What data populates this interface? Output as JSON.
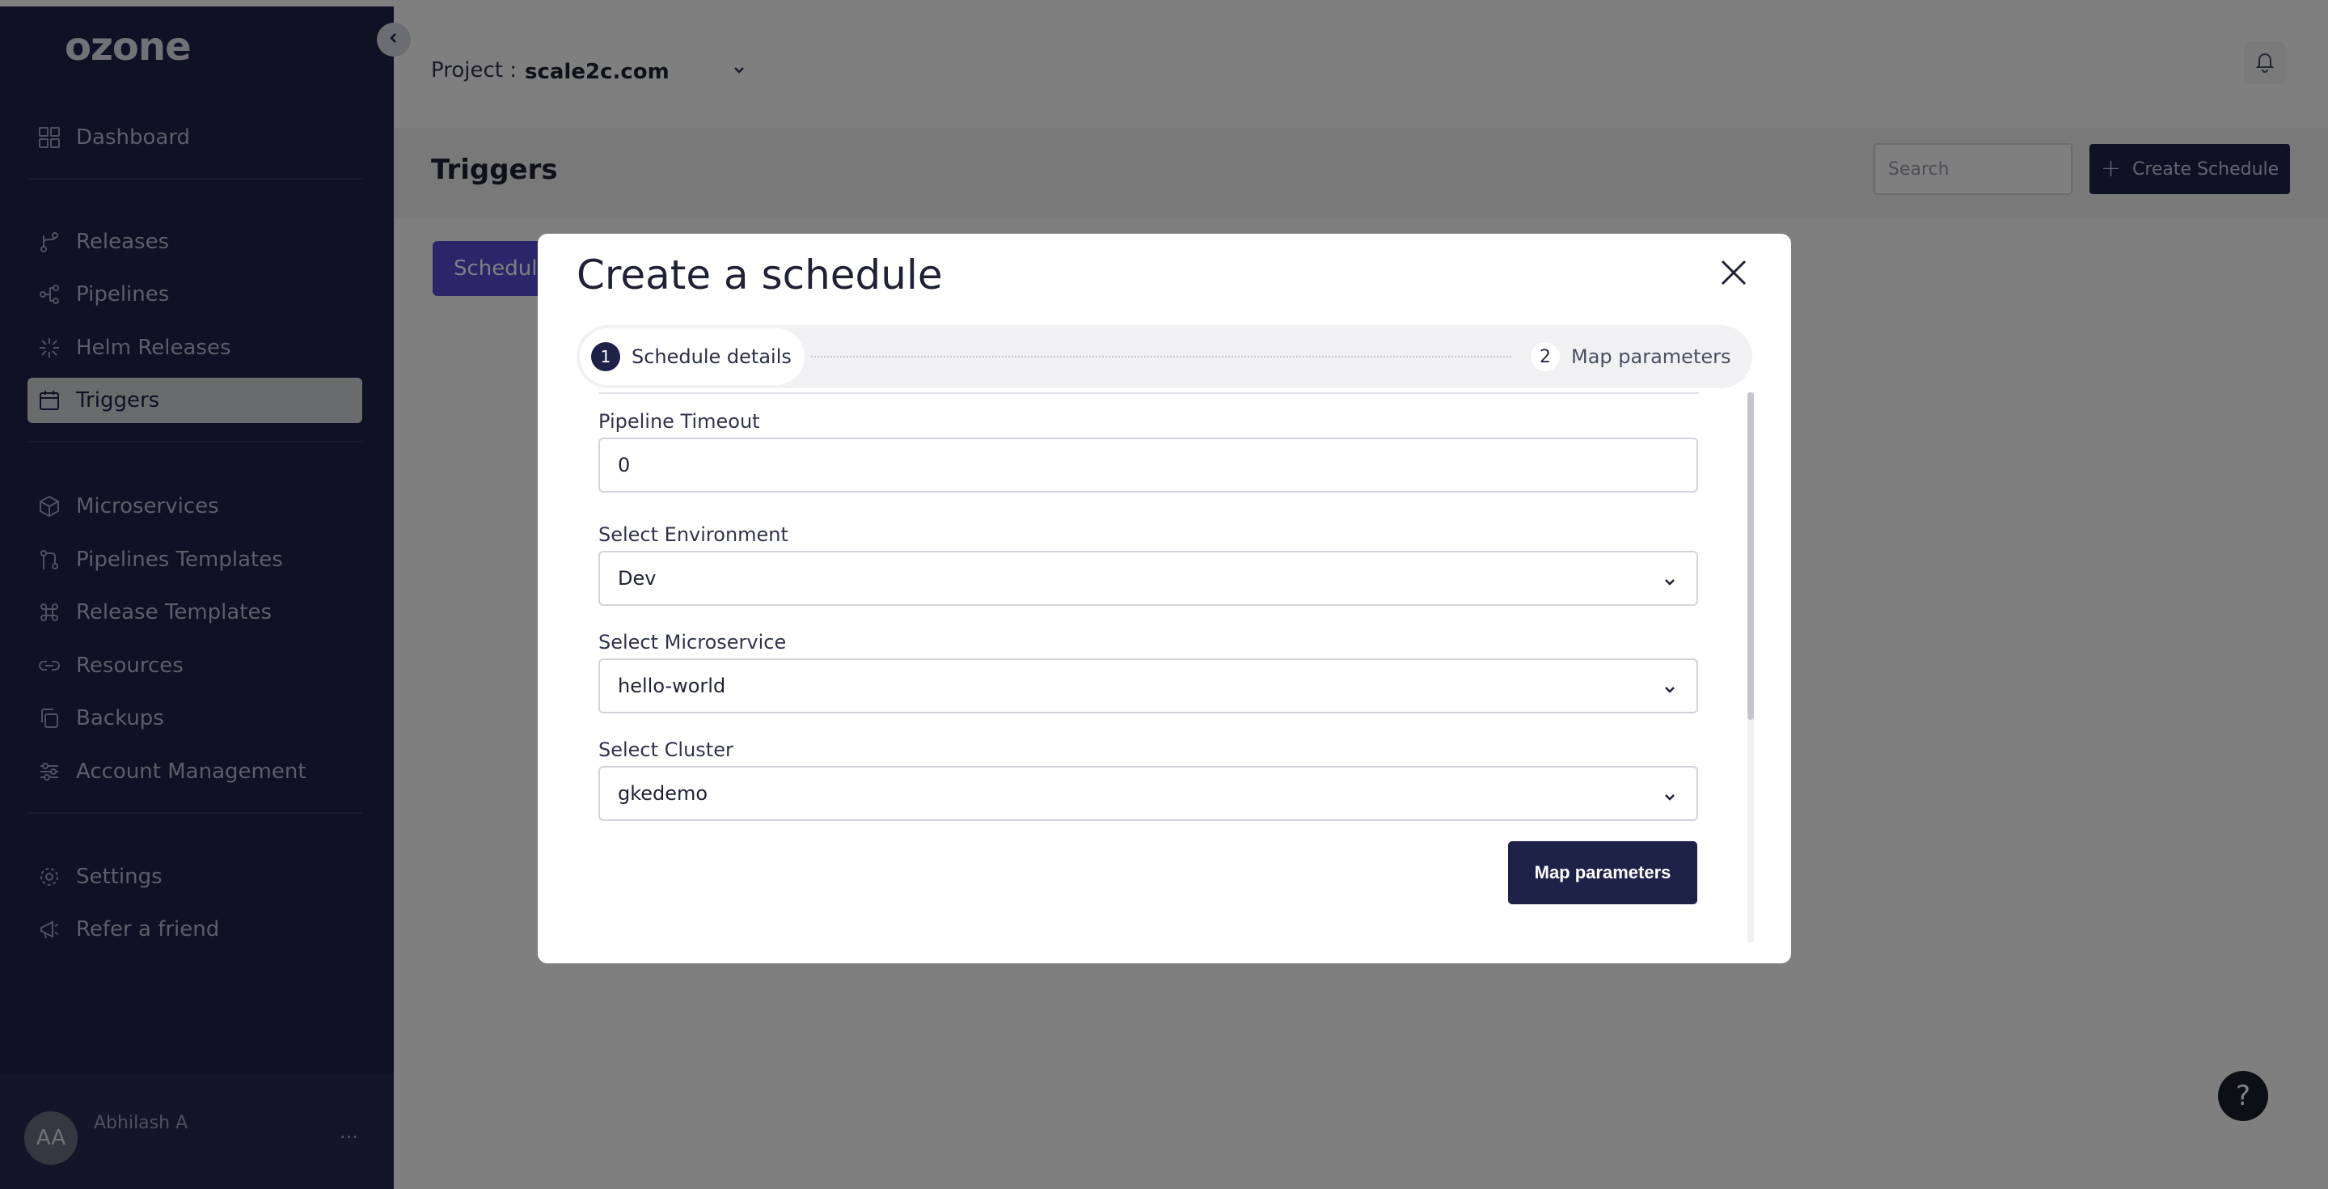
{
  "app": {
    "logo_text": "ozone"
  },
  "sidebar": {
    "items": [
      {
        "label": "Dashboard",
        "icon": "grid-icon"
      },
      {
        "label": "Releases",
        "icon": "branch-icon"
      },
      {
        "label": "Pipelines",
        "icon": "pipeline-icon"
      },
      {
        "label": "Helm Releases",
        "icon": "helm-icon"
      },
      {
        "label": "Triggers",
        "icon": "calendar-icon",
        "active": true
      },
      {
        "label": "Microservices",
        "icon": "cube-icon"
      },
      {
        "label": "Pipelines Templates",
        "icon": "template-icon"
      },
      {
        "label": "Release Templates",
        "icon": "command-icon"
      },
      {
        "label": "Resources",
        "icon": "link-icon"
      },
      {
        "label": "Backups",
        "icon": "copy-icon"
      },
      {
        "label": "Account Management",
        "icon": "sliders-icon"
      },
      {
        "label": "Settings",
        "icon": "gear-icon"
      },
      {
        "label": "Refer a friend",
        "icon": "megaphone-icon"
      }
    ],
    "user": {
      "initials": "AA",
      "name": "Abhilash A",
      "more": "···"
    }
  },
  "header": {
    "project_label": "Project :",
    "project_value": "scale2c.com"
  },
  "page": {
    "title": "Triggers",
    "search_placeholder": "Search",
    "create_button": "Create Schedule",
    "tab_label": "Schedule"
  },
  "modal": {
    "title": "Create a schedule",
    "steps": [
      {
        "num": "1",
        "label": "Schedule details",
        "active": true
      },
      {
        "num": "2",
        "label": "Map parameters",
        "active": false
      }
    ],
    "fields": {
      "pipeline_timeout": {
        "label": "Pipeline Timeout",
        "value": "0"
      },
      "environment": {
        "label": "Select Environment",
        "value": "Dev"
      },
      "microservice": {
        "label": "Select Microservice",
        "value": "hello-world"
      },
      "cluster": {
        "label": "Select Cluster",
        "value": "gkedemo"
      }
    },
    "primary_button": "Map parameters"
  },
  "help": {
    "label": "?"
  },
  "colors": {
    "sidebar_bg": "#1e2248",
    "accent_purple": "#5b4bd4",
    "primary_dark": "#1e2248"
  }
}
